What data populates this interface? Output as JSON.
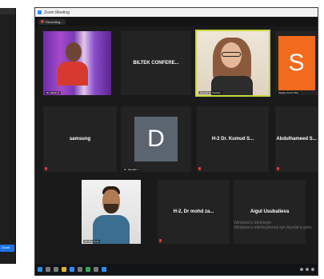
{
  "left_window": {
    "tab_label": "Zoom"
  },
  "window": {
    "title": "Zoom Meeting"
  },
  "toolbar": {
    "recording_label": "Recording..."
  },
  "tiles": [
    {
      "name": "",
      "caption": "Dr. Nilesh C"
    },
    {
      "name": "BILTEK CONFERE..."
    },
    {
      "name": "",
      "caption": "Daniela D. Carolino"
    },
    {
      "name": "S",
      "caption": "Sanjay Kumar Sha"
    },
    {
      "name": "samsung"
    },
    {
      "name": "D",
      "caption": "Dr. Saurabh J"
    },
    {
      "name": "H-2 Dr. Kumud S..."
    },
    {
      "name": "Abdulhameed S..."
    },
    {
      "name": "",
      "caption": "Dr. Ajay Kum"
    },
    {
      "name": "H-2, Dr mohd za..."
    },
    {
      "name": "Aigul Usubalieva"
    }
  ],
  "watermark": {
    "line1": "Windows'u Etkinleştir",
    "line2": "Windows'u etkinleştirmek için Ayarlar'a gidin."
  },
  "colors": {
    "accent": "#2d8cff",
    "active_speaker": "#c7d63a",
    "avatar_s": "#f26b1d",
    "avatar_d": "#5a6570",
    "recording": "#e53935"
  }
}
